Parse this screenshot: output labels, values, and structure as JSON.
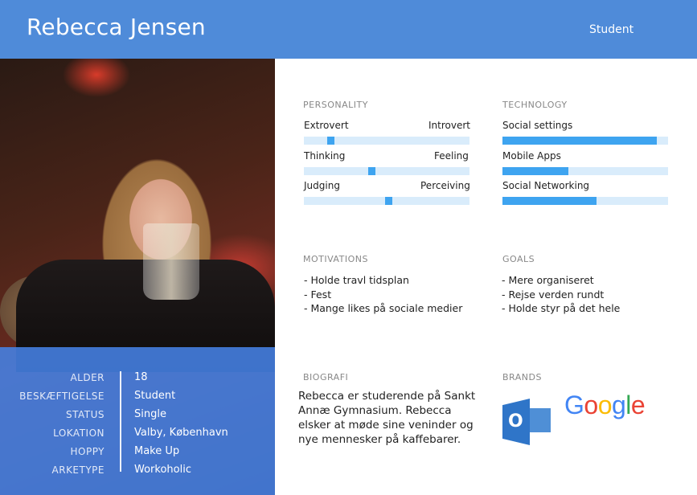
{
  "header": {
    "name": "Rebecca Jensen",
    "role": "Student"
  },
  "info": {
    "rows": [
      {
        "label": "ALDER",
        "value": "18"
      },
      {
        "label": "BESKÆFTIGELSE",
        "value": "Student"
      },
      {
        "label": "STATUS",
        "value": "Single"
      },
      {
        "label": "LOKATION",
        "value": "Valby, København"
      },
      {
        "label": "HOPPY",
        "value": "Make Up"
      },
      {
        "label": "ARKETYPE",
        "value": "Workoholic"
      }
    ]
  },
  "personality": {
    "title": "PERSONALITY",
    "sliders": [
      {
        "left": "Extrovert",
        "right": "Introvert",
        "value": 0.16
      },
      {
        "left": "Thinking",
        "right": "Feeling",
        "value": 0.41
      },
      {
        "left": "Judging",
        "right": "Perceiving",
        "value": 0.51
      }
    ]
  },
  "technology": {
    "title": "TECHNOLOGY",
    "bars": [
      {
        "label": "Social settings",
        "value": 0.93
      },
      {
        "label": "Mobile Apps",
        "value": 0.4
      },
      {
        "label": "Social Networking",
        "value": 0.57
      }
    ]
  },
  "motivations": {
    "title": "MOTIVATIONS",
    "items": [
      "- Holde travl tidsplan",
      "- Fest",
      "- Mange likes på sociale medier"
    ]
  },
  "goals": {
    "title": "GOALS",
    "items": [
      "- Mere organiseret",
      "- Rejse verden rundt",
      "- Holde styr på det hele"
    ]
  },
  "biografi": {
    "title": "BIOGRAFI",
    "text": "Rebecca er studerende på Sankt Annæ Gymnasium. Rebecca elsker at møde sine veninder og nye mennesker på kaffebarer."
  },
  "brands": {
    "title": "BRANDS",
    "outlook_letter": "O",
    "google_letters": [
      {
        "ch": "G",
        "color": "#4285F4"
      },
      {
        "ch": "o",
        "color": "#EA4335"
      },
      {
        "ch": "o",
        "color": "#FBBC05"
      },
      {
        "ch": "g",
        "color": "#4285F4"
      },
      {
        "ch": "l",
        "color": "#34A853"
      },
      {
        "ch": "e",
        "color": "#EA4335"
      }
    ]
  },
  "colors": {
    "header": "#4f8bd9",
    "accent": "#3ea4f0",
    "track": "#d9ecfb"
  }
}
